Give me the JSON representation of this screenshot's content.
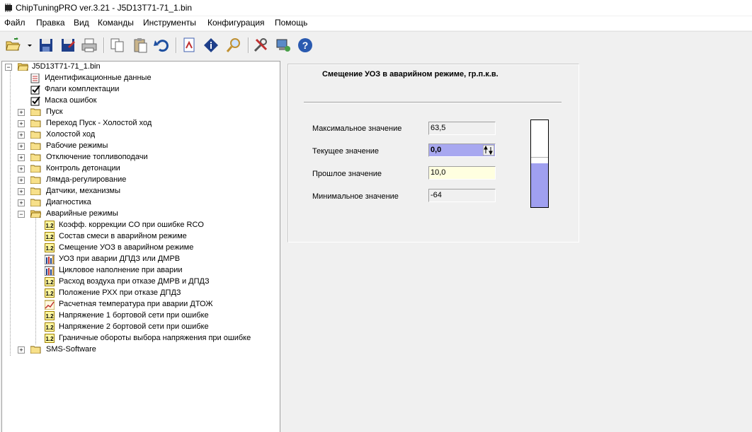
{
  "window": {
    "title": "ChipTuningPRO ver.3.21 - J5D13T71-71_1.bin"
  },
  "menu": [
    "Файл",
    "Правка",
    "Вид",
    "Команды",
    "Инструменты",
    "Конфигурация",
    "Помощь"
  ],
  "toolbar_icons": [
    "open-icon",
    "dropdown-arrow-icon",
    "save-icon",
    "save-as-icon",
    "print-icon",
    "copy-icon",
    "paste-icon",
    "undo-icon",
    "compare-icon",
    "info-icon",
    "search-icon",
    "tools-icon",
    "connect-icon",
    "help-icon"
  ],
  "tree": {
    "root": "J5D13T71-71_1.bin",
    "top_items": [
      "Идентификационные данные",
      "Флаги комплектации",
      "Маска ошибок"
    ],
    "folders": [
      "Пуск",
      "Переход Пуск - Холостой ход",
      "Холостой ход",
      "Рабочие режимы",
      "Отключение топливоподачи",
      "Контроль детонации",
      "Лямда-регулирование",
      "Датчики, механизмы",
      "Диагностика",
      "Аварийные режимы"
    ],
    "emergency_children": [
      {
        "label": "Коэфф. коррекции CO при ошибке RCO",
        "icon": "1.2"
      },
      {
        "label": "Состав смеси в аварийном режиме",
        "icon": "1.2"
      },
      {
        "label": "Смещение УОЗ в аварийном режиме",
        "icon": "1.2"
      },
      {
        "label": "УОЗ при аварии ДПДЗ или ДМРВ",
        "icon": "table-icon"
      },
      {
        "label": "Цикловое наполнение при аварии",
        "icon": "table-icon"
      },
      {
        "label": "Расход воздуха при отказе ДМРВ и ДПДЗ",
        "icon": "1.2"
      },
      {
        "label": "Положение РХХ при отказе ДПДЗ",
        "icon": "1.2"
      },
      {
        "label": "Расчетная температура при аварии ДТОЖ",
        "icon": "graph-icon"
      },
      {
        "label": "Напряжение 1 бортовой сети при ошибке",
        "icon": "1.2"
      },
      {
        "label": "Напряжение 2 бортовой сети при ошибке",
        "icon": "1.2"
      },
      {
        "label": "Граничные обороты выбора напряжения при ошибке",
        "icon": "1.2"
      }
    ],
    "last_folder": "SMS-Software"
  },
  "panel": {
    "title": "Смещение УОЗ в аварийном режиме, гр.п.к.в.",
    "max_label": "Максимальное значение",
    "max_value": "63,5",
    "current_label": "Текущее значение",
    "current_value": "0,0",
    "prev_label": "Прошлое значение",
    "prev_value": "10,0",
    "min_label": "Минимальное значение",
    "min_value": "-64",
    "gauge_fill_fraction": 0.5,
    "gauge_prev_fraction": 0.57,
    "gauge_color": "#a0a0f0"
  }
}
